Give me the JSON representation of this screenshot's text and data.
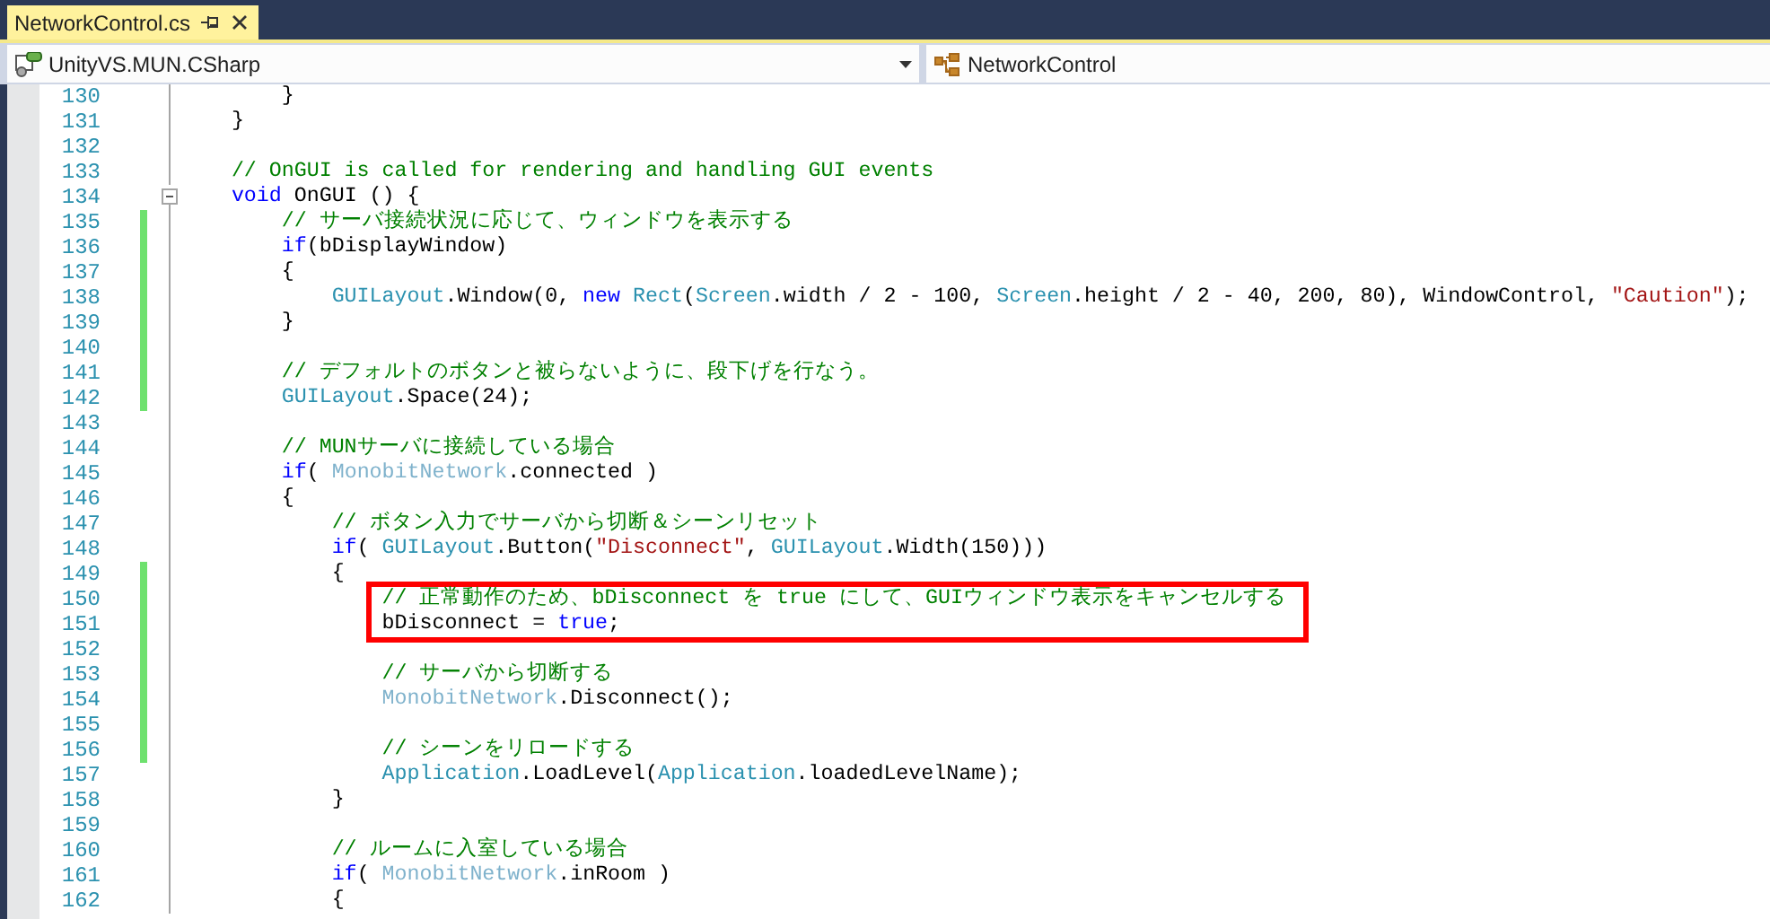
{
  "tab": {
    "label": "NetworkControl.cs",
    "selected": true
  },
  "nav": {
    "project": "UnityVS.MUN.CSharp",
    "type": "NetworkControl"
  },
  "lines": [
    {
      "number": "130",
      "changed": false,
      "highlighted": false,
      "tokens": [
        {
          "text": "        }",
          "kind": "plain"
        }
      ]
    },
    {
      "number": "131",
      "changed": false,
      "highlighted": false,
      "tokens": [
        {
          "text": "    }",
          "kind": "plain"
        }
      ]
    },
    {
      "number": "132",
      "changed": false,
      "highlighted": false
    },
    {
      "number": "133",
      "changed": false,
      "highlighted": false,
      "tokens": [
        {
          "text": "    // OnGUI is called for rendering and handling GUI events",
          "kind": "comment"
        }
      ]
    },
    {
      "number": "134",
      "changed": false,
      "highlighted": false,
      "expanded": true,
      "tokens": [
        {
          "text": "    void",
          "kind": "keyword"
        },
        {
          "text": " OnGUI () {",
          "kind": "plain"
        }
      ]
    },
    {
      "number": "135",
      "changed": true,
      "highlighted": false,
      "tokens": [
        {
          "text": "        // サーバ接続状況に応じて、ウィンドウを表示する",
          "kind": "comment"
        }
      ]
    },
    {
      "number": "136",
      "changed": true,
      "highlighted": false,
      "tokens": [
        {
          "text": "        if",
          "kind": "keyword"
        },
        {
          "text": "(bDisplayWindow)",
          "kind": "plain"
        }
      ]
    },
    {
      "number": "137",
      "changed": true,
      "highlighted": false,
      "tokens": [
        {
          "text": "        {",
          "kind": "plain"
        }
      ]
    },
    {
      "number": "138",
      "changed": true,
      "highlighted": false,
      "tokens": [
        {
          "text": "            GUILayout",
          "kind": "type"
        },
        {
          "text": ".Window(0,",
          "kind": "plain"
        },
        {
          "text": " new",
          "kind": "keyword"
        },
        {
          "text": " Rect",
          "kind": "type"
        },
        {
          "text": "(",
          "kind": "plain"
        },
        {
          "text": "Screen",
          "kind": "type"
        },
        {
          "text": ".width / 2 - 100,",
          "kind": "plain"
        },
        {
          "text": " Screen",
          "kind": "type"
        },
        {
          "text": ".height / 2 - 40, 200, 80), WindowControl,",
          "kind": "plain"
        },
        {
          "text": " \"Caution\"",
          "kind": "string"
        },
        {
          "text": ");",
          "kind": "plain"
        }
      ]
    },
    {
      "number": "139",
      "changed": true,
      "highlighted": false,
      "tokens": [
        {
          "text": "        }",
          "kind": "plain"
        }
      ]
    },
    {
      "number": "140",
      "changed": true,
      "highlighted": false
    },
    {
      "number": "141",
      "changed": true,
      "highlighted": false,
      "tokens": [
        {
          "text": "        // デフォルトのボタンと被らないように、段下げを行なう。",
          "kind": "comment"
        }
      ]
    },
    {
      "number": "142",
      "changed": true,
      "highlighted": false,
      "tokens": [
        {
          "text": "        GUILayout",
          "kind": "type"
        },
        {
          "text": ".Space(24);",
          "kind": "plain"
        }
      ]
    },
    {
      "number": "143",
      "changed": false,
      "highlighted": false
    },
    {
      "number": "144",
      "changed": false,
      "highlighted": false,
      "tokens": [
        {
          "text": "        // MUNサーバに接続している場合",
          "kind": "comment"
        }
      ]
    },
    {
      "number": "145",
      "changed": false,
      "highlighted": false,
      "tokens": [
        {
          "text": "        if",
          "kind": "keyword"
        },
        {
          "text": "(",
          "kind": "plain"
        },
        {
          "text": " MonobitNetwork",
          "kind": "faded"
        },
        {
          "text": ".connected )",
          "kind": "plain"
        }
      ]
    },
    {
      "number": "146",
      "changed": false,
      "highlighted": false,
      "tokens": [
        {
          "text": "        {",
          "kind": "plain"
        }
      ]
    },
    {
      "number": "147",
      "changed": false,
      "highlighted": false,
      "tokens": [
        {
          "text": "            // ボタン入力でサーバから切断＆シーンリセット",
          "kind": "comment"
        }
      ]
    },
    {
      "number": "148",
      "changed": false,
      "highlighted": false,
      "tokens": [
        {
          "text": "            if",
          "kind": "keyword"
        },
        {
          "text": "(",
          "kind": "plain"
        },
        {
          "text": " GUILayout",
          "kind": "type"
        },
        {
          "text": ".Button(",
          "kind": "plain"
        },
        {
          "text": "\"Disconnect\"",
          "kind": "string"
        },
        {
          "text": ",",
          "kind": "plain"
        },
        {
          "text": " GUILayout",
          "kind": "type"
        },
        {
          "text": ".Width(150)))",
          "kind": "plain"
        }
      ]
    },
    {
      "number": "149",
      "changed": true,
      "highlighted": false,
      "tokens": [
        {
          "text": "            {",
          "kind": "plain"
        }
      ]
    },
    {
      "number": "150",
      "changed": true,
      "highlighted": true,
      "tokens": [
        {
          "text": "                // 正常動作のため、bDisconnect を true にして、GUIウィンドウ表示をキャンセルする",
          "kind": "comment"
        }
      ]
    },
    {
      "number": "151",
      "changed": true,
      "highlighted": true,
      "tokens": [
        {
          "text": "                bDisconnect =",
          "kind": "plain"
        },
        {
          "text": " true",
          "kind": "keyword"
        },
        {
          "text": ";",
          "kind": "plain"
        }
      ]
    },
    {
      "number": "152",
      "changed": true,
      "highlighted": false
    },
    {
      "number": "153",
      "changed": true,
      "highlighted": false,
      "tokens": [
        {
          "text": "                // サーバから切断する",
          "kind": "comment"
        }
      ]
    },
    {
      "number": "154",
      "changed": true,
      "highlighted": false,
      "tokens": [
        {
          "text": "                MonobitNetwork",
          "kind": "faded"
        },
        {
          "text": ".Disconnect();",
          "kind": "plain"
        }
      ]
    },
    {
      "number": "155",
      "changed": true,
      "highlighted": false
    },
    {
      "number": "156",
      "changed": true,
      "highlighted": false,
      "tokens": [
        {
          "text": "                // シーンをリロードする",
          "kind": "comment"
        }
      ]
    },
    {
      "number": "157",
      "changed": false,
      "highlighted": false,
      "tokens": [
        {
          "text": "                Application",
          "kind": "type"
        },
        {
          "text": ".LoadLevel(",
          "kind": "plain"
        },
        {
          "text": "Application",
          "kind": "type"
        },
        {
          "text": ".loadedLevelName);",
          "kind": "plain"
        }
      ]
    },
    {
      "number": "158",
      "changed": false,
      "highlighted": false,
      "tokens": [
        {
          "text": "            }",
          "kind": "plain"
        }
      ]
    },
    {
      "number": "159",
      "changed": false,
      "highlighted": false
    },
    {
      "number": "160",
      "changed": false,
      "highlighted": false,
      "tokens": [
        {
          "text": "            // ルームに入室している場合",
          "kind": "comment"
        }
      ]
    },
    {
      "number": "161",
      "changed": false,
      "highlighted": false,
      "tokens": [
        {
          "text": "            if",
          "kind": "keyword"
        },
        {
          "text": "(",
          "kind": "plain"
        },
        {
          "text": " MonobitNetwork",
          "kind": "faded"
        },
        {
          "text": ".inRoom )",
          "kind": "plain"
        }
      ]
    },
    {
      "number": "162",
      "changed": false,
      "highlighted": false,
      "tokens": [
        {
          "text": "            {",
          "kind": "plain"
        }
      ]
    }
  ]
}
